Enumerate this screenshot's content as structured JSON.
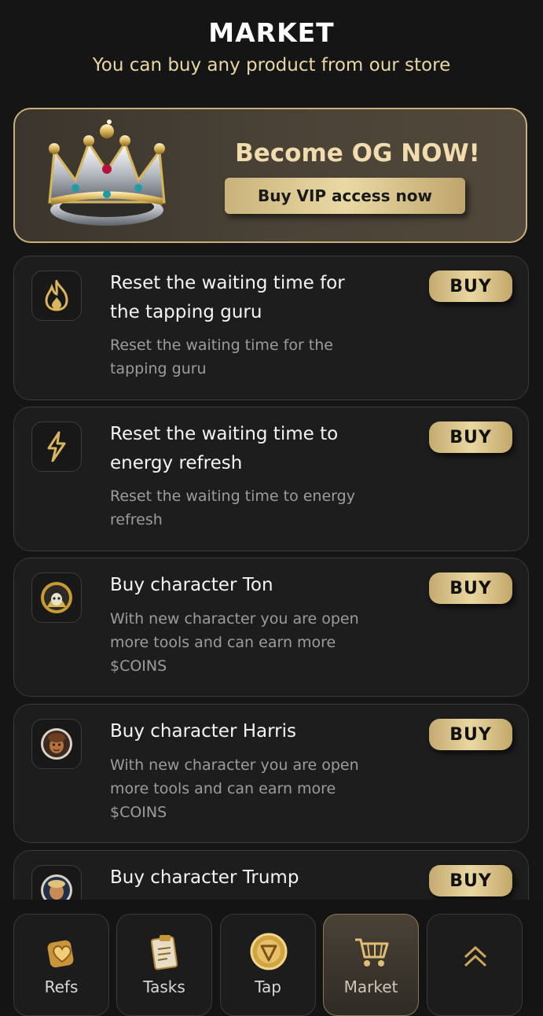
{
  "header": {
    "title": "MARKET",
    "subtitle": "You can buy any product from our store"
  },
  "vip_banner": {
    "title": "Become OG NOW!",
    "button_label": "Buy VIP access now",
    "icon": "crown-icon"
  },
  "products": [
    {
      "title": "Reset the waiting time for the tapping guru",
      "description": "Reset the waiting time for the tapping guru",
      "button_label": "BUY",
      "icon": "flame-icon"
    },
    {
      "title": "Reset the waiting time to energy refresh",
      "description": "Reset the waiting time to energy refresh",
      "button_label": "BUY",
      "icon": "lightning-icon"
    },
    {
      "title": "Buy character Ton",
      "description": "With new character you are open more tools and can earn more $COINS",
      "button_label": "BUY",
      "icon": "character-ton-avatar"
    },
    {
      "title": "Buy character Harris",
      "description": "With new character you are open more tools and can earn more $COINS",
      "button_label": "BUY",
      "icon": "character-harris-avatar"
    },
    {
      "title": "Buy character Trump",
      "description": "",
      "button_label": "BUY",
      "icon": "character-trump-avatar"
    }
  ],
  "nav": {
    "items": [
      {
        "label": "Refs",
        "icon": "heart-badge-icon"
      },
      {
        "label": "Tasks",
        "icon": "clipboard-icon"
      },
      {
        "label": "Tap",
        "icon": "coin-icon"
      },
      {
        "label": "Market",
        "icon": "shopping-cart-icon",
        "active": true
      },
      {
        "label": "",
        "icon": "chevron-double-up-icon"
      }
    ]
  },
  "colors": {
    "background": "#151515",
    "accent_gold": "#e2cc92",
    "card_background": "#1d1d1d"
  }
}
